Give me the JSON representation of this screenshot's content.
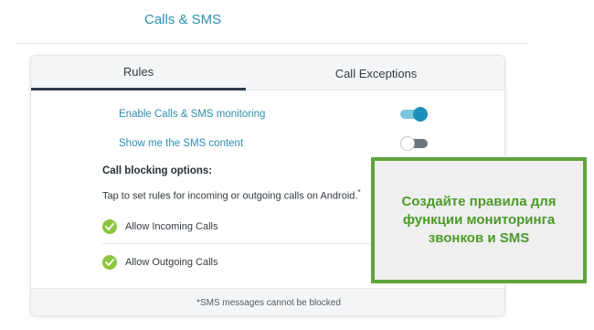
{
  "header": {
    "title": "Calls & SMS"
  },
  "tabs": [
    {
      "label": "Rules",
      "active": true
    },
    {
      "label": "Call Exceptions",
      "active": false
    }
  ],
  "toggles": [
    {
      "label": "Enable Calls & SMS monitoring",
      "on": true
    },
    {
      "label": "Show me the SMS content",
      "on": false
    }
  ],
  "blocking": {
    "heading": "Call blocking options:",
    "help_text": "Tap to set rules for incoming or outgoing calls on Android.",
    "help_footnote_mark": "*",
    "options": [
      {
        "label": "Allow Incoming Calls",
        "checked": true
      },
      {
        "label": "Allow Outgoing Calls",
        "checked": true
      }
    ]
  },
  "footer": {
    "note": "*SMS messages cannot be blocked"
  },
  "callout": {
    "text": "Создайте правила для функции мониторинга звонков и SMS"
  },
  "colors": {
    "accent": "#2c8fae",
    "toggle_on": "#1d8fb9",
    "check_green": "#8cc63e",
    "callout_border": "#5fa33b",
    "callout_text": "#4c9a2a"
  },
  "icons": {
    "check": "check-icon"
  }
}
